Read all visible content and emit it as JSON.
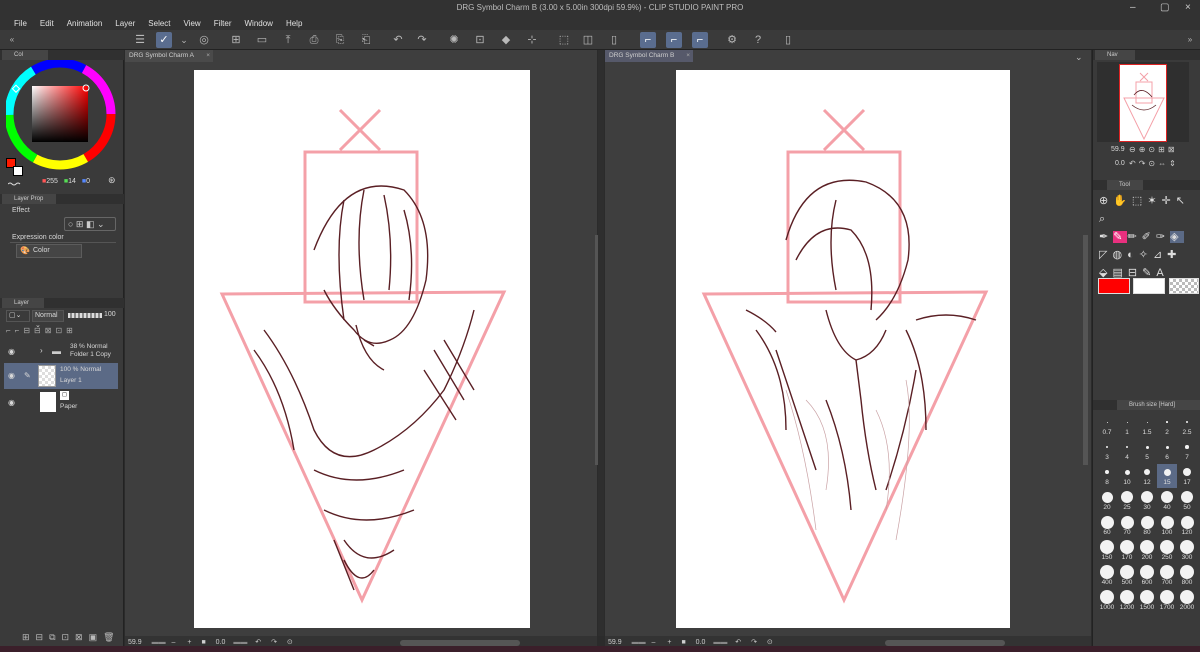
{
  "window": {
    "title": "DRG Symbol Charm B (3.00 x 5.00in 300dpi 59.9%) - CLIP STUDIO PAINT PRO"
  },
  "menu": [
    "File",
    "Edit",
    "Animation",
    "Layer",
    "Select",
    "View",
    "Filter",
    "Window",
    "Help"
  ],
  "color_panel": {
    "tab": "Col",
    "r": "255",
    "g": "14",
    "b": "0",
    "main_color": "#ff1a00",
    "sub_color": "#ffffff"
  },
  "layer_property": {
    "tab": "Layer Prop",
    "effect_label": "Effect",
    "expression_label": "Expression color",
    "expression_value": "Color"
  },
  "layer_panel": {
    "tab": "Layer",
    "blend_mode": "Normal",
    "opacity": "100",
    "layers": [
      {
        "line1": "38 % Normal",
        "line2": "Folder 1 Copy"
      },
      {
        "line1": "100 % Normal",
        "line2": "Layer 1"
      },
      {
        "line1": "",
        "line2": "Paper"
      }
    ]
  },
  "canvas_a": {
    "tab": "DRG Symbol Charm A",
    "zoom": "59.9",
    "angle": "0.0"
  },
  "canvas_b": {
    "tab": "DRG Symbol Charm B",
    "zoom": "59.9",
    "angle": "0.0"
  },
  "navigator": {
    "tab": "Nav",
    "zoom": "59.9",
    "angle": "0.0"
  },
  "tool_panel": {
    "tab": "Tool",
    "main_color": "#ff0000",
    "sub_color": "#ffffff"
  },
  "brush_size": {
    "tab": "Brush size [Hard]",
    "sizes": [
      "0.7",
      "1",
      "1.5",
      "2",
      "2.5",
      "3",
      "4",
      "5",
      "6",
      "7",
      "8",
      "10",
      "12",
      "15",
      "17",
      "20",
      "25",
      "30",
      "40",
      "50",
      "60",
      "70",
      "80",
      "100",
      "120",
      "150",
      "170",
      "200",
      "250",
      "300",
      "400",
      "500",
      "600",
      "700",
      "800",
      "1000",
      "1200",
      "1500",
      "1700",
      "2000"
    ],
    "selected": "15"
  }
}
